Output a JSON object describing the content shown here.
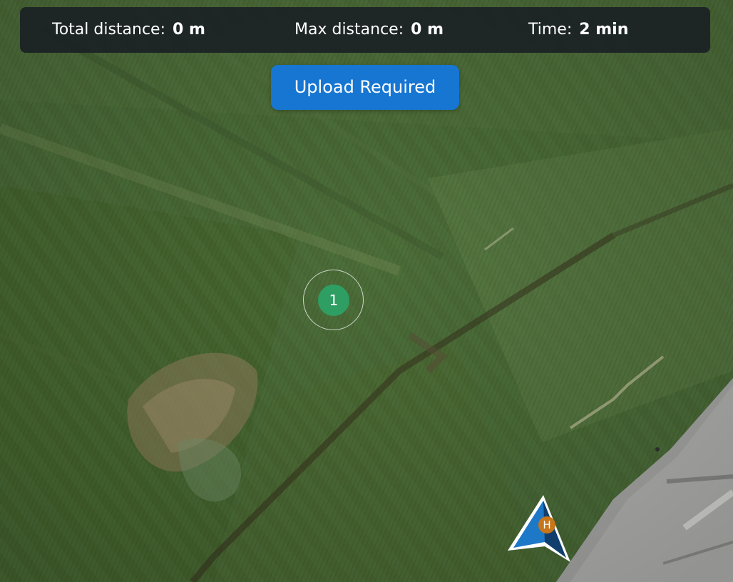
{
  "stats": {
    "total_distance": {
      "label": "Total distance:",
      "value": "0 m"
    },
    "max_distance": {
      "label": "Max distance:",
      "value": "0 m"
    },
    "time": {
      "label": "Time:",
      "value": "2 min"
    }
  },
  "upload_button": {
    "label": "Upload Required"
  },
  "waypoints": [
    {
      "number": "1",
      "color": "#2e9e63"
    }
  ],
  "home": {
    "badge": "H",
    "badge_color": "#c7761a",
    "aircraft_color": "#1e78c8"
  },
  "map": {
    "type": "satellite",
    "icon": "map-satellite"
  }
}
